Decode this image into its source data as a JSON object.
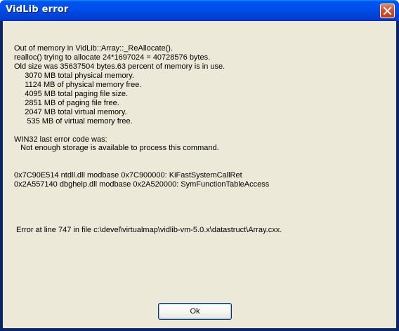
{
  "window": {
    "title": "VidLib error"
  },
  "message": {
    "lines": [
      "Out of memory in VidLib::Array::_ReAllocate().",
      "realloc() trying to allocate 24*1697024 = 40728576 bytes.",
      "Old size was 35637504 bytes.63 percent of memory is in use.",
      "     3070 MB total physical memory.",
      "     1124 MB of physical memory free.",
      "     4095 MB total paging file size.",
      "     2851 MB of paging file free.",
      "     2047 MB total virtual memory.",
      "      535 MB of virtual memory free.",
      "",
      "WIN32 last error code was:",
      "   Not enough storage is available to process this command.",
      "",
      "",
      "0x7C90E514 ntdll.dll modbase 0x7C900000: KiFastSystemCallRet",
      "0x2A557140 dbghelp.dll modbase 0x2A520000: SymFunctionTableAccess",
      "",
      "",
      "",
      "",
      " Error at line 747 in file c:\\devel\\virtualmap\\vidlib-vm-5.0.x\\datastruct\\Array.cxx."
    ]
  },
  "buttons": {
    "ok_label": "Ok"
  },
  "icons": {
    "close": "close-icon"
  },
  "colors": {
    "titlebar": "#0054e3",
    "client_background": "#ece9d8",
    "close_button": "#d5502f"
  }
}
